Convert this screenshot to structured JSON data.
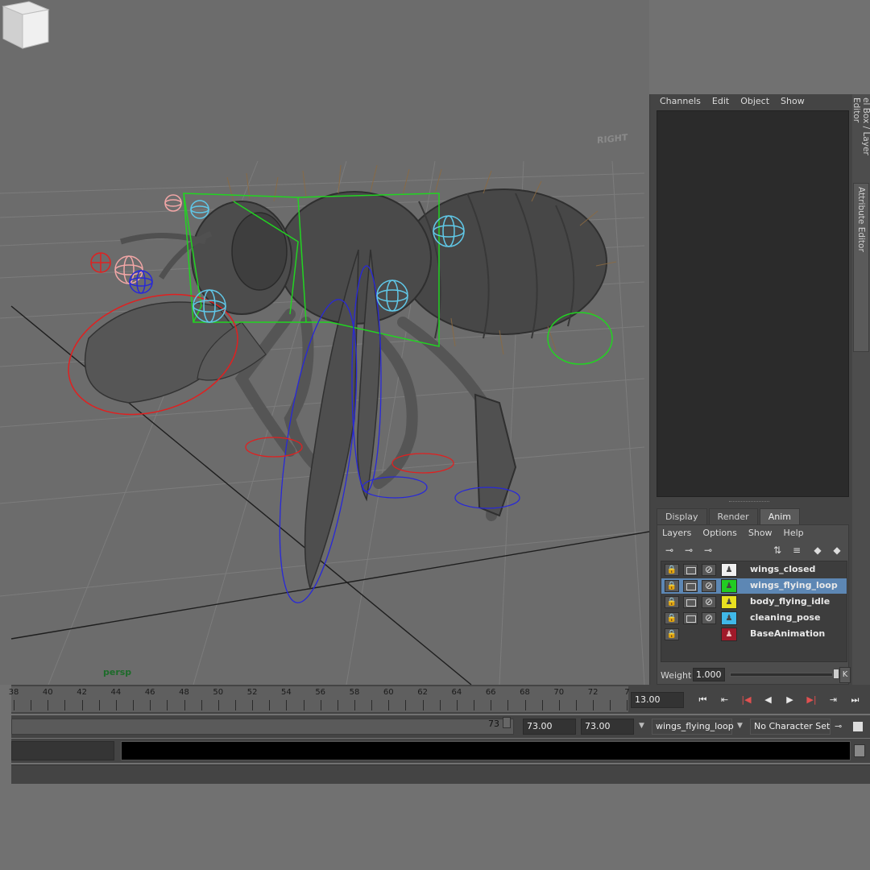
{
  "viewport": {
    "camera_label": "persp",
    "viewcube_label": "RIGHT"
  },
  "side_tabs": {
    "channel_box_tab": "el Box / Layer Editor",
    "attribute_editor_tab": "Attribute Editor"
  },
  "channel_box": {
    "menu": [
      "Channels",
      "Edit",
      "Object",
      "Show"
    ]
  },
  "layer_editor": {
    "tabs": [
      {
        "label": "Display",
        "active": false
      },
      {
        "label": "Render",
        "active": false
      },
      {
        "label": "Anim",
        "active": true
      }
    ],
    "menu": [
      "Layers",
      "Options",
      "Show",
      "Help"
    ],
    "layers": [
      {
        "name": "wings_closed",
        "color": "#f0f0f0",
        "selected": false
      },
      {
        "name": "wings_flying_loop",
        "color": "#22cc22",
        "selected": true
      },
      {
        "name": "body_flying_idle",
        "color": "#e8e020",
        "selected": false
      },
      {
        "name": "cleaning_pose",
        "color": "#40b8e8",
        "selected": false
      },
      {
        "name": "BaseAnimation",
        "color": "#a01a2a",
        "selected": false
      }
    ],
    "weight_label": "Weight",
    "weight_value": "1.000",
    "weight_fraction": 1.0,
    "key_button": "K"
  },
  "timeline": {
    "tick_labels": [
      "38",
      "40",
      "42",
      "44",
      "46",
      "48",
      "50",
      "52",
      "54",
      "56",
      "58",
      "60",
      "62",
      "64",
      "66",
      "68",
      "70",
      "72",
      "7"
    ],
    "current_frame": "13.00",
    "playback_icons": [
      "go-to-start-icon",
      "step-back-key-icon",
      "step-back-frame-icon",
      "play-backward-icon",
      "play-forward-icon",
      "step-forward-frame-icon",
      "step-forward-key-icon",
      "go-to-end-icon"
    ]
  },
  "range": {
    "range_end_marker": "73",
    "end_time": "73.00",
    "playback_end": "73.00",
    "anim_layer_select": "wings_flying_loop",
    "character_set": "No Character Set"
  },
  "colors": {
    "panel_bg": "#444444",
    "viewport_bg": "#6c6c6c",
    "selection": "#5d87b4",
    "camera_label": "#1d6b2a"
  }
}
